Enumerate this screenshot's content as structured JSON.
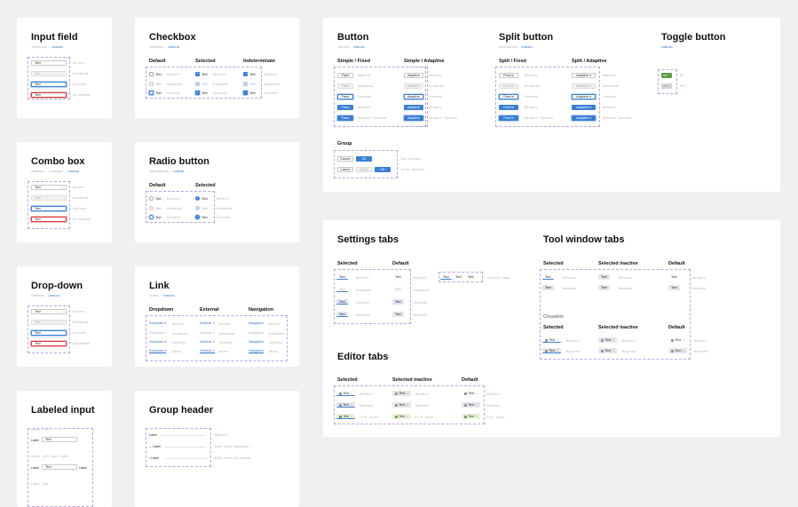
{
  "cards": {
    "input_field": {
      "title": "Input field",
      "sub_a": "JTEXTFIELD · ",
      "sub_b": "RUNNING"
    },
    "checkbox": {
      "title": "Checkbox",
      "sub_a": "JCHECKBOX · ",
      "sub_b": "RUNNING"
    },
    "combo_box": {
      "title": "Combo box",
      "sub_a": "COMBOBOX · JCOMBOBOX · ",
      "sub_b": "RUNNING"
    },
    "radio_button": {
      "title": "Radio button",
      "sub_a": "JRADIOBUTTON · ",
      "sub_b": "RUNNING"
    },
    "drop_down": {
      "title": "Drop-down",
      "sub_a": "COMBOBOX · ",
      "sub_b": "RUNNING"
    },
    "link": {
      "title": "Link",
      "sub_a": "JLABEL · ",
      "sub_b": "RUNNING"
    },
    "labeled_input": {
      "title": "Labeled input"
    },
    "group_header": {
      "title": "Group header"
    },
    "button": {
      "title": "Button",
      "sub_a": "JBUTTON · ",
      "sub_b": "RUNNING"
    },
    "split_button": {
      "title": "Split button",
      "sub_a": "SPLITBUTTON · ",
      "sub_b": "RUNNING"
    },
    "toggle_button": {
      "title": "Toggle button",
      "sub_b": "RUNNING"
    },
    "settings_tabs": {
      "title": "Settings tabs"
    },
    "tool_window_tabs": {
      "title": "Tool window tabs"
    },
    "editor_tabs": {
      "title": "Editor tabs"
    }
  },
  "common": {
    "text": "Text",
    "states": {
      "active": "Active",
      "disabled": "Disabled",
      "focused": "Focused",
      "validation": "Validated",
      "default": "Default",
      "hover": "Hover"
    }
  },
  "checkbox": {
    "cols": [
      "Default",
      "Selected",
      "Indeterminate"
    ]
  },
  "radio": {
    "cols": [
      "Default",
      "Selected"
    ]
  },
  "link": {
    "cols": [
      "Dropdown",
      "External",
      "Navigation"
    ],
    "dropdown": "Dropdown ▾",
    "external": "External ↗",
    "navigation": "Navigation"
  },
  "labeled_input": {
    "notes": [
      "Label left",
      "Label left and right",
      "Label top"
    ],
    "label": "Label",
    "label_right": "Label"
  },
  "group_header": {
    "items": [
      "Label",
      "Label",
      "Label"
    ],
    "notes": [
      "Regular",
      "With icon expanded",
      "With icon collapsed"
    ]
  },
  "button": {
    "cols": [
      "Simple / Fixed",
      "Simple / Adaptive"
    ],
    "fixed": "Fixed",
    "adaptive": "Adaptive",
    "notes": [
      "Regular",
      "Disabled",
      "Focused",
      "Default",
      "Default Focused"
    ],
    "group_title": "Group",
    "cancel": "Cancel",
    "ok": "OK",
    "apply": "Apply",
    "group_notes": [
      "Two buttons",
      "Three buttons"
    ]
  },
  "split": {
    "cols": [
      "Split / Fixed",
      "Split / Adaptive"
    ],
    "fixed": "Fixed  ▾",
    "adaptive": "Adaptive  ▾",
    "notes": [
      "Regular",
      "Disabled",
      "Focused",
      "Default",
      "Default Focused"
    ]
  },
  "toggle": {
    "on": "ON",
    "off": "OFF",
    "notes": [
      "On",
      "Off"
    ]
  },
  "settings_tabs": {
    "cols": [
      "Selected",
      "Default"
    ],
    "notes": [
      "Default",
      "Disabled",
      "Focused",
      "Hovered"
    ],
    "example_note": "Control tabs"
  },
  "tool_tabs": {
    "cols": [
      "Selected",
      "Selected inactive",
      "Default"
    ],
    "closable_title": "Closable",
    "notes": [
      "Default",
      "Hovered"
    ]
  },
  "editor_tabs": {
    "cols": [
      "Selected",
      "Selected inactive",
      "Default"
    ],
    "notes": [
      "Default",
      "Hovered",
      "File color"
    ]
  }
}
